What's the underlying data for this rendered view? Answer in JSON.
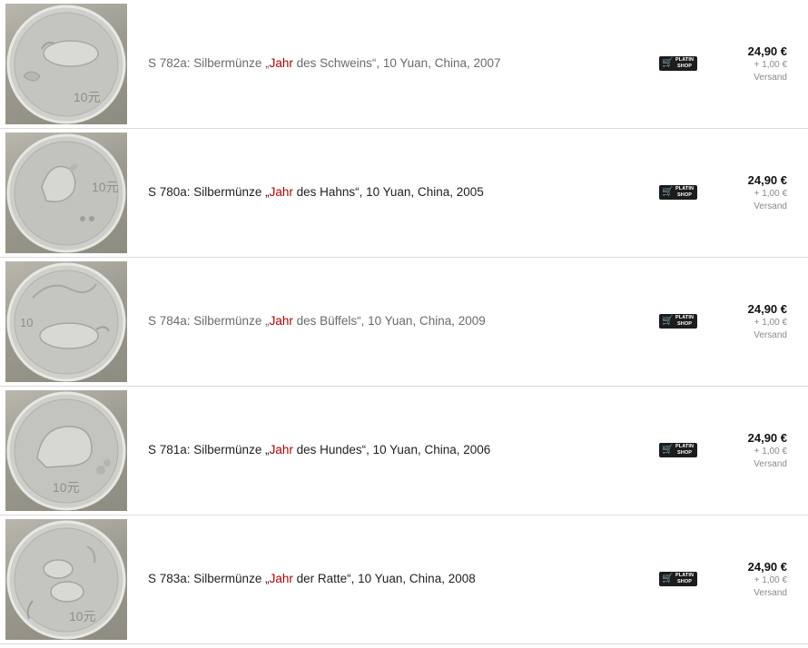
{
  "listings": [
    {
      "prefix": "S 782a: Silbermünze „",
      "highlight": "Jahr",
      "suffix": " des Schweins“, 10 Yuan, China, 2007",
      "tone": "muted",
      "coin_icon": "pig-coin-icon",
      "badge_top": "PLATIN",
      "badge_bottom": "SHOP",
      "price": "24,90 €",
      "shipping": "+ 1,00 €",
      "shipping_label": "Versand"
    },
    {
      "prefix": "S 780a: Silbermünze „",
      "highlight": "Jahr",
      "suffix": " des Hahns“, 10 Yuan, China, 2005",
      "tone": "dark",
      "coin_icon": "rooster-coin-icon",
      "badge_top": "PLATIN",
      "badge_bottom": "SHOP",
      "price": "24,90 €",
      "shipping": "+ 1,00 €",
      "shipping_label": "Versand"
    },
    {
      "prefix": "S 784a: Silbermünze „",
      "highlight": "Jahr",
      "suffix": " des Büffels“, 10 Yuan, China, 2009",
      "tone": "muted",
      "coin_icon": "ox-coin-icon",
      "badge_top": "PLATIN",
      "badge_bottom": "SHOP",
      "price": "24,90 €",
      "shipping": "+ 1,00 €",
      "shipping_label": "Versand"
    },
    {
      "prefix": "S 781a: Silbermünze „",
      "highlight": "Jahr",
      "suffix": " des Hundes“, 10 Yuan, China, 2006",
      "tone": "dark",
      "coin_icon": "dog-coin-icon",
      "badge_top": "PLATIN",
      "badge_bottom": "SHOP",
      "price": "24,90 €",
      "shipping": "+ 1,00 €",
      "shipping_label": "Versand"
    },
    {
      "prefix": "S 783a: Silbermünze „",
      "highlight": "Jahr",
      "suffix": " der Ratte“, 10 Yuan, China, 2008",
      "tone": "dark",
      "coin_icon": "rat-coin-icon",
      "badge_top": "PLATIN",
      "badge_bottom": "SHOP",
      "price": "24,90 €",
      "shipping": "+ 1,00 €",
      "shipping_label": "Versand"
    }
  ],
  "colors": {
    "highlight": "#b30000",
    "muted_title": "#6b6b6b",
    "dark_title": "#1f1f1f",
    "price": "#111111",
    "shipping": "#8a8a8a",
    "badge": "#1c1c1c"
  }
}
